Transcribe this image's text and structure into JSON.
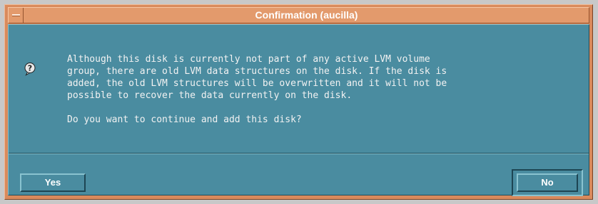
{
  "window": {
    "title": "Confirmation (aucilla)",
    "menu_icon": "window-menu-icon"
  },
  "message": {
    "icon": "question-icon",
    "lines": [
      "Although this disk is currently not part of any active LVM volume",
      "group, there are old LVM data structures on the disk. If the disk is",
      "added, the old LVM structures will be overwritten and it will not be",
      "possible to recover the data currently on the disk."
    ],
    "question": "Do you want to continue and add this disk?"
  },
  "buttons": {
    "yes": "Yes",
    "no": "No",
    "default": "no"
  },
  "colors": {
    "title_bar": "#e39a6c",
    "frame": "#d98a5c",
    "dialog_background": "#4a8ca0",
    "text": "#f2f2f2"
  }
}
